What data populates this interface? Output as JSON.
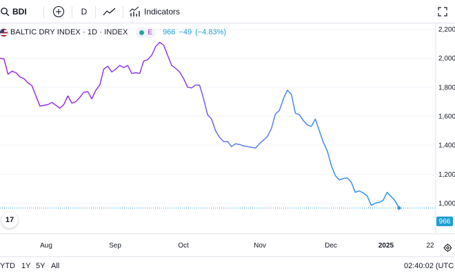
{
  "toolbar": {
    "symbol": "BDI",
    "interval": "D",
    "indicators_label": "Indicators",
    "icons": {
      "search": "search-icon",
      "add": "add-circle-icon",
      "chart_type": "line-chart-icon",
      "indicators": "indicators-icon",
      "fullscreen": "fullscreen-icon"
    }
  },
  "legend": {
    "title": "BALTIC DRY INDEX · 1D · INDEX",
    "status_exchange": "E",
    "last": "966",
    "change": "−49",
    "change_pct": "(−4.83%)"
  },
  "price_scale": {
    "labels": [
      "2,200",
      "2,000",
      "1,800",
      "1,600",
      "1,400",
      "1,200",
      "1,000"
    ],
    "last_price_badge": "966"
  },
  "time_scale": {
    "labels": [
      "Aug",
      "Sep",
      "Oct",
      "Nov",
      "Dec",
      "2025",
      "22"
    ]
  },
  "bottom_bar": {
    "ranges": [
      "YTD",
      "1Y",
      "5Y",
      "All"
    ],
    "time": "02:40:02 (UTC"
  },
  "logo_text": "17",
  "colors": {
    "line_start": "#9c27e6",
    "line_end": "#2196f3",
    "last_price": "#1e9fd4",
    "grid": "#f0f3fa"
  },
  "chart_data": {
    "type": "line",
    "series_name": "BALTIC DRY INDEX",
    "ylim": [
      900,
      2200
    ],
    "y_ticks": [
      1000,
      1200,
      1400,
      1600,
      1800,
      2000,
      2200
    ],
    "x_ticks": [
      "Aug",
      "Sep",
      "Oct",
      "Nov",
      "Dec",
      "2025",
      "22"
    ],
    "values": [
      2000,
      1995,
      1890,
      1910,
      1900,
      1870,
      1860,
      1830,
      1810,
      1740,
      1670,
      1675,
      1680,
      1695,
      1675,
      1655,
      1680,
      1740,
      1690,
      1700,
      1730,
      1765,
      1770,
      1720,
      1780,
      1815,
      1925,
      1945,
      1905,
      1925,
      1950,
      1935,
      1950,
      1895,
      1900,
      1895,
      1980,
      1990,
      2020,
      2080,
      2110,
      2090,
      2020,
      1950,
      1930,
      1905,
      1860,
      1800,
      1795,
      1815,
      1815,
      1720,
      1610,
      1580,
      1500,
      1455,
      1425,
      1425,
      1390,
      1410,
      1405,
      1395,
      1390,
      1385,
      1380,
      1410,
      1435,
      1460,
      1515,
      1615,
      1640,
      1720,
      1780,
      1750,
      1620,
      1610,
      1570,
      1540,
      1530,
      1580,
      1500,
      1420,
      1360,
      1260,
      1190,
      1160,
      1170,
      1175,
      1145,
      1075,
      1085,
      1070,
      1050,
      985,
      1000,
      1005,
      1020,
      1075,
      1045,
      1015,
      966
    ],
    "last_value": 966,
    "change": -49,
    "change_pct": -4.83
  }
}
